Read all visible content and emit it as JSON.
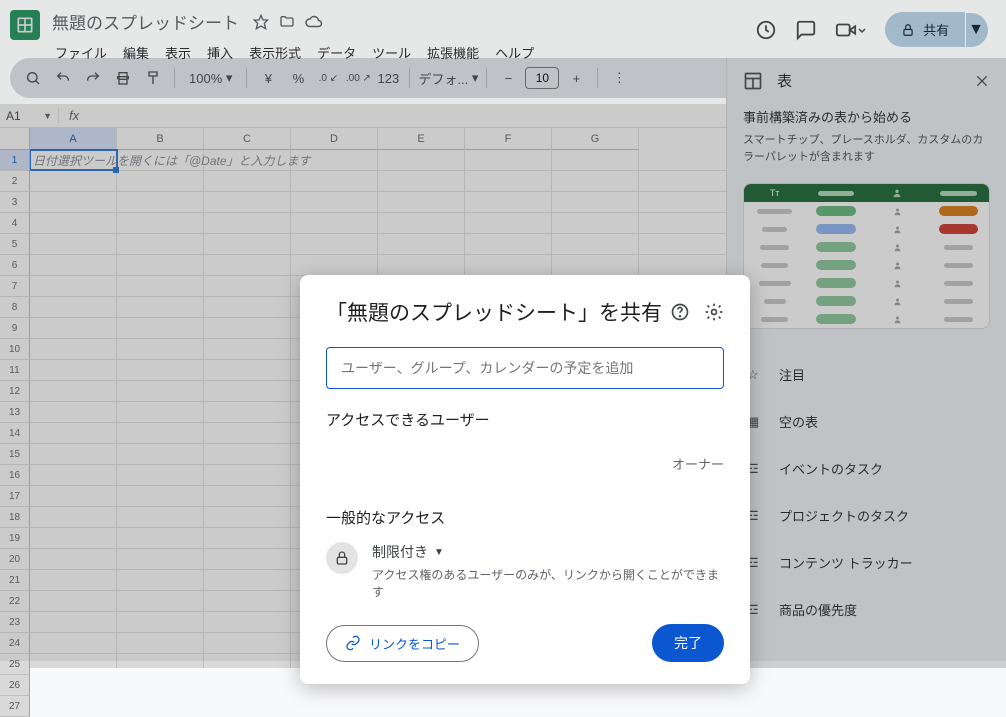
{
  "header": {
    "doc_title": "無題のスプレッドシート",
    "share_label": "共有"
  },
  "menu": {
    "file": "ファイル",
    "edit": "編集",
    "view": "表示",
    "insert": "挿入",
    "format": "表示形式",
    "data": "データ",
    "tools": "ツール",
    "extensions": "拡張機能",
    "help": "ヘルプ"
  },
  "toolbar": {
    "zoom": "100%",
    "currency": "¥",
    "percent": "%",
    "dec_dec": ".0",
    "dec_inc": ".00",
    "num_format": "123",
    "font": "デフォ...",
    "minus": "−",
    "font_size": "10",
    "plus": "+"
  },
  "formula": {
    "name_box": "A1",
    "fx": "fx"
  },
  "grid": {
    "columns": [
      "A",
      "B",
      "C",
      "D",
      "E",
      "F",
      "G"
    ],
    "rows": [
      1,
      2,
      3,
      4,
      5,
      6,
      7,
      8,
      9,
      10,
      11,
      12,
      13,
      14,
      15,
      16,
      17,
      18,
      19,
      20,
      21,
      22,
      23,
      24,
      25,
      26,
      27
    ],
    "active_cell_hint": "日付選択ツールを開くには「@Date」と入力します"
  },
  "sidepanel": {
    "title": "表",
    "subtitle": "事前構築済みの表から始める",
    "description": "スマートチップ、プレースホルダ、カスタムのカラーパレットが含まれます",
    "items": {
      "featured": "注目",
      "empty": "空の表",
      "event": "イベントのタスク",
      "project": "プロジェクトのタスク",
      "content": "コンテンツ トラッカー",
      "priority": "商品の優先度"
    }
  },
  "modal": {
    "title": "「無題のスプレッドシート」を共有",
    "input_placeholder": "ユーザー、グループ、カレンダーの予定を追加",
    "access_users": "アクセスできるユーザー",
    "owner": "オーナー",
    "general_access": "一般的なアクセス",
    "restricted": "制限付き",
    "restricted_desc": "アクセス権のあるユーザーのみが、リンクから開くことができます",
    "copy_link": "リンクをコピー",
    "done": "完了"
  }
}
